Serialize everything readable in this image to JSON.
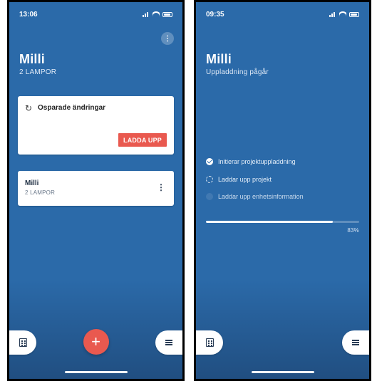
{
  "left_screen": {
    "status_time": "13:06",
    "title": "Milli",
    "subtitle": "2 LAMPOR",
    "unsaved_card": {
      "title": "Osparade ändringar",
      "button_label": "LADDA UPP"
    },
    "project_card": {
      "name": "Milli",
      "lamp_count": "2 LAMPOR"
    }
  },
  "right_screen": {
    "status_time": "09:35",
    "title": "Milli",
    "subtitle": "Uppladdning pågår",
    "steps": [
      {
        "label": "Initierar projektuppladdning",
        "state": "done"
      },
      {
        "label": "Laddar upp projekt",
        "state": "in_progress"
      },
      {
        "label": "Laddar upp enhetsinformation",
        "state": "pending"
      }
    ],
    "progress": {
      "value_percent": 83,
      "label": "83%"
    }
  },
  "colors": {
    "app_blue": "#2b6aa9",
    "accent_red": "#e9594f",
    "white": "#ffffff"
  },
  "icons": {
    "top_menu": "more-vertical-icon",
    "sync": "sync-icon",
    "project_menu": "more-vertical-icon",
    "building": "building-icon",
    "plus": "plus-icon",
    "menu": "menu-icon",
    "check": "check-icon",
    "spinner": "spinner-icon",
    "pending": "pending-icon"
  }
}
